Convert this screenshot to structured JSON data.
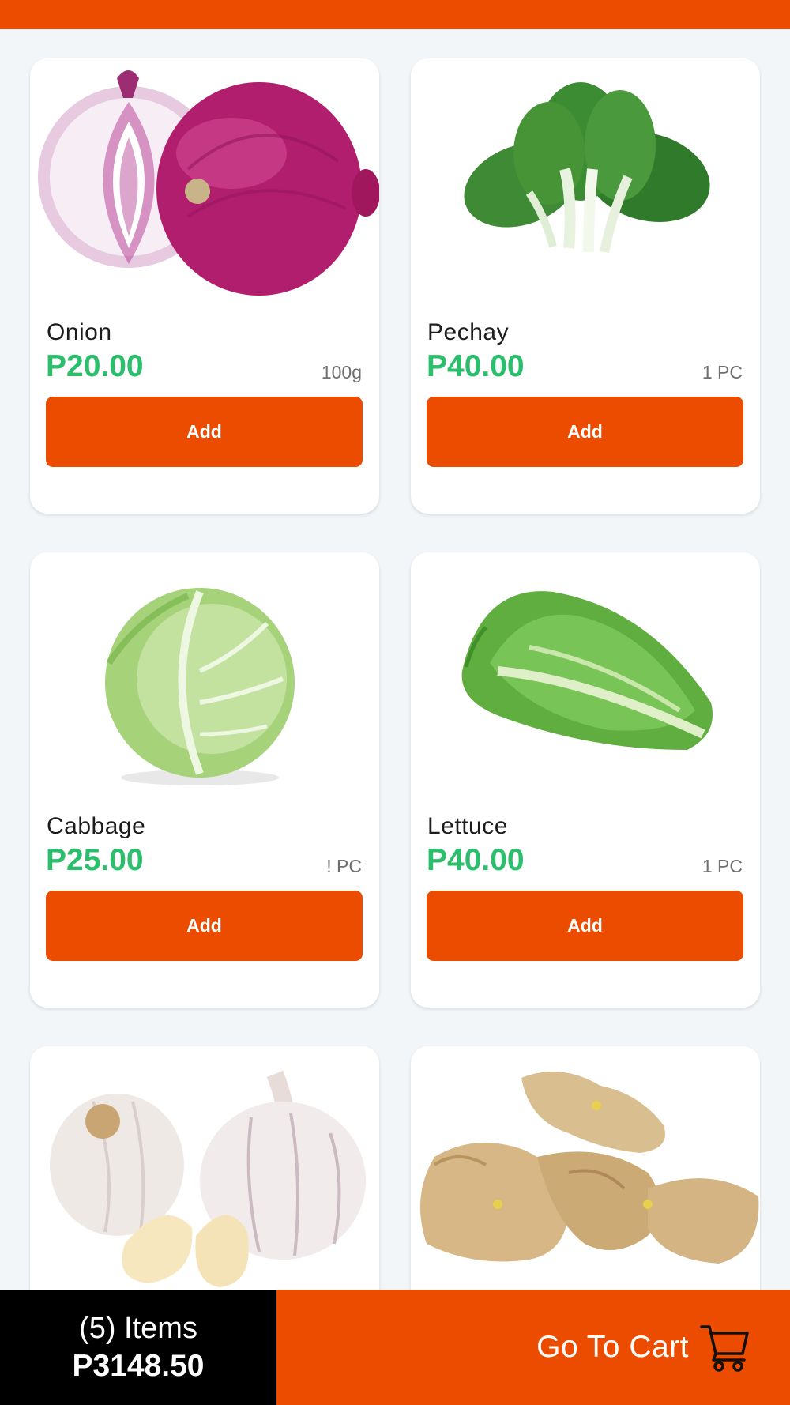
{
  "colors": {
    "accent": "#ec4c00",
    "price": "#2bbf6d",
    "summary_bg": "#000000"
  },
  "products": [
    {
      "name": "Onion",
      "price": "P20.00",
      "unit": "100g",
      "add_label": "Add",
      "image": "onion-image"
    },
    {
      "name": "Pechay",
      "price": "P40.00",
      "unit": "1 PC",
      "add_label": "Add",
      "image": "pechay-image"
    },
    {
      "name": "Cabbage",
      "price": "P25.00",
      "unit": "! PC",
      "add_label": "Add",
      "image": "cabbage-image"
    },
    {
      "name": "Lettuce",
      "price": "P40.00",
      "unit": "1 PC",
      "add_label": "Add",
      "image": "lettuce-image"
    },
    {
      "name": "",
      "price": "",
      "unit": "",
      "add_label": "",
      "image": "garlic-image"
    },
    {
      "name": "",
      "price": "",
      "unit": "",
      "add_label": "",
      "image": "ginger-image"
    }
  ],
  "cart": {
    "items_label": "(5) Items",
    "total": "P3148.50",
    "go_to_cart_label": "Go To Cart",
    "icon": "shopping-cart-icon"
  }
}
